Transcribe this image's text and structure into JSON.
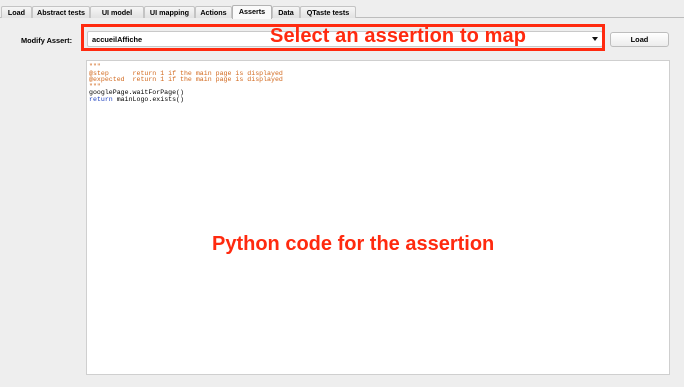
{
  "tabs": [
    {
      "label": "Load",
      "active": false
    },
    {
      "label": "Abstract tests",
      "active": false
    },
    {
      "label": "UI model",
      "active": false
    },
    {
      "label": "UI mapping",
      "active": false
    },
    {
      "label": "Actions",
      "active": false
    },
    {
      "label": "Asserts",
      "active": true
    },
    {
      "label": "Data",
      "active": false
    },
    {
      "label": "QTaste tests",
      "active": false
    }
  ],
  "form": {
    "modify_label": "Modify Assert:",
    "selected_assert": "accueilAffiche",
    "load_button": "Load"
  },
  "code_lines": [
    {
      "cls": "c-str",
      "text": "\"\"\""
    },
    {
      "cls": "c-str",
      "text": "@step      return 1 if the main page is displayed"
    },
    {
      "cls": "c-str",
      "text": "@expected  return 1 if the main page is displayed"
    },
    {
      "cls": "c-str",
      "text": "\"\"\""
    },
    {
      "cls": "c-txt",
      "text": "googlePage.waitForPage()"
    },
    {
      "parts": [
        {
          "cls": "c-kw",
          "text": "return"
        },
        {
          "cls": "c-txt",
          "text": " mainLogo.exists()"
        }
      ]
    }
  ],
  "annotations": {
    "select_callout": "Select an assertion to map",
    "code_callout": "Python code for the assertion"
  },
  "colors": {
    "annotation": "#ff2a0f",
    "string": "#d2691e",
    "keyword": "#1c3fbf"
  }
}
